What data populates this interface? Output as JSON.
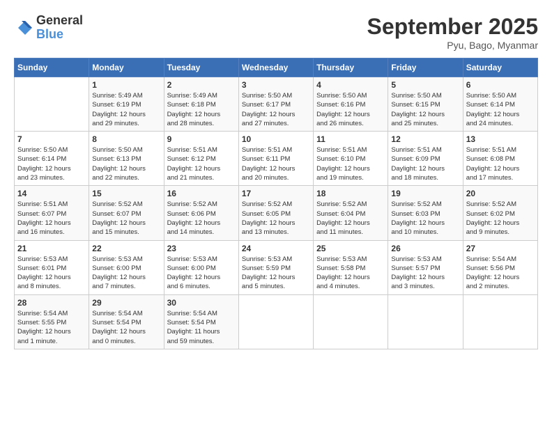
{
  "header": {
    "logo_line1": "General",
    "logo_line2": "Blue",
    "month": "September 2025",
    "location": "Pyu, Bago, Myanmar"
  },
  "days_of_week": [
    "Sunday",
    "Monday",
    "Tuesday",
    "Wednesday",
    "Thursday",
    "Friday",
    "Saturday"
  ],
  "weeks": [
    [
      {
        "day": "",
        "info": ""
      },
      {
        "day": "1",
        "info": "Sunrise: 5:49 AM\nSunset: 6:19 PM\nDaylight: 12 hours\nand 29 minutes."
      },
      {
        "day": "2",
        "info": "Sunrise: 5:49 AM\nSunset: 6:18 PM\nDaylight: 12 hours\nand 28 minutes."
      },
      {
        "day": "3",
        "info": "Sunrise: 5:50 AM\nSunset: 6:17 PM\nDaylight: 12 hours\nand 27 minutes."
      },
      {
        "day": "4",
        "info": "Sunrise: 5:50 AM\nSunset: 6:16 PM\nDaylight: 12 hours\nand 26 minutes."
      },
      {
        "day": "5",
        "info": "Sunrise: 5:50 AM\nSunset: 6:15 PM\nDaylight: 12 hours\nand 25 minutes."
      },
      {
        "day": "6",
        "info": "Sunrise: 5:50 AM\nSunset: 6:14 PM\nDaylight: 12 hours\nand 24 minutes."
      }
    ],
    [
      {
        "day": "7",
        "info": "Sunrise: 5:50 AM\nSunset: 6:14 PM\nDaylight: 12 hours\nand 23 minutes."
      },
      {
        "day": "8",
        "info": "Sunrise: 5:50 AM\nSunset: 6:13 PM\nDaylight: 12 hours\nand 22 minutes."
      },
      {
        "day": "9",
        "info": "Sunrise: 5:51 AM\nSunset: 6:12 PM\nDaylight: 12 hours\nand 21 minutes."
      },
      {
        "day": "10",
        "info": "Sunrise: 5:51 AM\nSunset: 6:11 PM\nDaylight: 12 hours\nand 20 minutes."
      },
      {
        "day": "11",
        "info": "Sunrise: 5:51 AM\nSunset: 6:10 PM\nDaylight: 12 hours\nand 19 minutes."
      },
      {
        "day": "12",
        "info": "Sunrise: 5:51 AM\nSunset: 6:09 PM\nDaylight: 12 hours\nand 18 minutes."
      },
      {
        "day": "13",
        "info": "Sunrise: 5:51 AM\nSunset: 6:08 PM\nDaylight: 12 hours\nand 17 minutes."
      }
    ],
    [
      {
        "day": "14",
        "info": "Sunrise: 5:51 AM\nSunset: 6:07 PM\nDaylight: 12 hours\nand 16 minutes."
      },
      {
        "day": "15",
        "info": "Sunrise: 5:52 AM\nSunset: 6:07 PM\nDaylight: 12 hours\nand 15 minutes."
      },
      {
        "day": "16",
        "info": "Sunrise: 5:52 AM\nSunset: 6:06 PM\nDaylight: 12 hours\nand 14 minutes."
      },
      {
        "day": "17",
        "info": "Sunrise: 5:52 AM\nSunset: 6:05 PM\nDaylight: 12 hours\nand 13 minutes."
      },
      {
        "day": "18",
        "info": "Sunrise: 5:52 AM\nSunset: 6:04 PM\nDaylight: 12 hours\nand 11 minutes."
      },
      {
        "day": "19",
        "info": "Sunrise: 5:52 AM\nSunset: 6:03 PM\nDaylight: 12 hours\nand 10 minutes."
      },
      {
        "day": "20",
        "info": "Sunrise: 5:52 AM\nSunset: 6:02 PM\nDaylight: 12 hours\nand 9 minutes."
      }
    ],
    [
      {
        "day": "21",
        "info": "Sunrise: 5:53 AM\nSunset: 6:01 PM\nDaylight: 12 hours\nand 8 minutes."
      },
      {
        "day": "22",
        "info": "Sunrise: 5:53 AM\nSunset: 6:00 PM\nDaylight: 12 hours\nand 7 minutes."
      },
      {
        "day": "23",
        "info": "Sunrise: 5:53 AM\nSunset: 6:00 PM\nDaylight: 12 hours\nand 6 minutes."
      },
      {
        "day": "24",
        "info": "Sunrise: 5:53 AM\nSunset: 5:59 PM\nDaylight: 12 hours\nand 5 minutes."
      },
      {
        "day": "25",
        "info": "Sunrise: 5:53 AM\nSunset: 5:58 PM\nDaylight: 12 hours\nand 4 minutes."
      },
      {
        "day": "26",
        "info": "Sunrise: 5:53 AM\nSunset: 5:57 PM\nDaylight: 12 hours\nand 3 minutes."
      },
      {
        "day": "27",
        "info": "Sunrise: 5:54 AM\nSunset: 5:56 PM\nDaylight: 12 hours\nand 2 minutes."
      }
    ],
    [
      {
        "day": "28",
        "info": "Sunrise: 5:54 AM\nSunset: 5:55 PM\nDaylight: 12 hours\nand 1 minute."
      },
      {
        "day": "29",
        "info": "Sunrise: 5:54 AM\nSunset: 5:54 PM\nDaylight: 12 hours\nand 0 minutes."
      },
      {
        "day": "30",
        "info": "Sunrise: 5:54 AM\nSunset: 5:54 PM\nDaylight: 11 hours\nand 59 minutes."
      },
      {
        "day": "",
        "info": ""
      },
      {
        "day": "",
        "info": ""
      },
      {
        "day": "",
        "info": ""
      },
      {
        "day": "",
        "info": ""
      }
    ]
  ]
}
